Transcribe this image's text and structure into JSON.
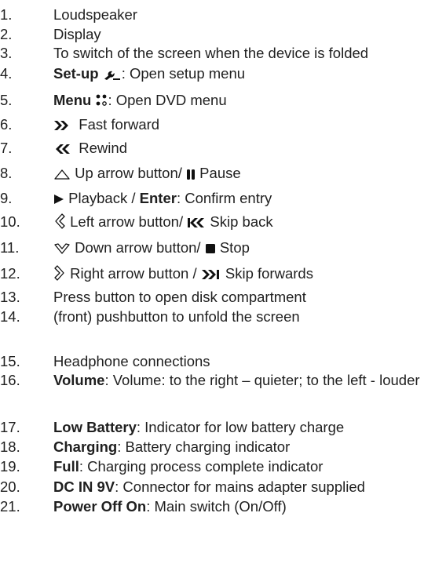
{
  "items": [
    {
      "num": "1.",
      "segments": [
        {
          "text": "Loudspeaker"
        }
      ]
    },
    {
      "num": "2.",
      "segments": [
        {
          "text": "Display"
        }
      ]
    },
    {
      "num": "3.",
      "segments": [
        {
          "text": "To switch of the screen when the device is folded"
        }
      ]
    },
    {
      "num": "4.",
      "segments": [
        {
          "text": "Set-up ",
          "bold": true
        },
        {
          "icon": "wrench-icon"
        },
        {
          "text": ": Open setup menu"
        }
      ]
    },
    {
      "num": "5.",
      "segments": [
        {
          "text": "Menu ",
          "bold": true
        },
        {
          "icon": "menu-dots-icon"
        },
        {
          "text": ": Open DVD menu"
        }
      ]
    },
    {
      "num": "6.",
      "segments": [
        {
          "icon": "fast-forward-icon"
        },
        {
          "text": "  Fast forward"
        }
      ]
    },
    {
      "num": "7.",
      "segments": [
        {
          "icon": "rewind-icon"
        },
        {
          "text": "  Rewind"
        }
      ]
    },
    {
      "num": "8.",
      "segments": [
        {
          "icon": "up-arrow-icon"
        },
        {
          "text": " Up arrow button/ "
        },
        {
          "icon": "pause-icon"
        },
        {
          "text": " Pause"
        }
      ]
    },
    {
      "num": "9.",
      "segments": [
        {
          "icon": "play-icon"
        },
        {
          "text": " Playback / "
        },
        {
          "text": "Enter",
          "bold": true
        },
        {
          "text": ": Confirm entry"
        }
      ]
    },
    {
      "num": "10.",
      "segments": [
        {
          "icon": "left-arrow-icon"
        },
        {
          "text": " Left arrow button/ "
        },
        {
          "icon": "skip-back-icon"
        },
        {
          "text": " Skip back"
        }
      ]
    },
    {
      "num": "11.",
      "segments": [
        {
          "icon": "down-arrow-icon"
        },
        {
          "text": " Down arrow button/ "
        },
        {
          "icon": "stop-icon"
        },
        {
          "text": " Stop"
        }
      ]
    },
    {
      "num": "12.",
      "segments": [
        {
          "icon": "right-arrow-icon"
        },
        {
          "text": " Right arrow button / "
        },
        {
          "icon": "skip-forward-icon"
        },
        {
          "text": " Skip forwards"
        }
      ]
    },
    {
      "num": "13.",
      "segments": [
        {
          "text": "Press button to open disk compartment"
        }
      ]
    },
    {
      "num": "14.",
      "segments": [
        {
          "text": "(front) pushbutton to unfold the screen"
        }
      ]
    },
    {
      "num": "15.",
      "segments": [
        {
          "text": "Headphone connections"
        }
      ]
    },
    {
      "num": "16.",
      "segments": [
        {
          "text": "Volume",
          "bold": true
        },
        {
          "text": ": Volume: to the right – quieter; to the left - louder"
        }
      ]
    },
    {
      "num": "17.",
      "segments": [
        {
          "text": "Low Battery",
          "bold": true
        },
        {
          "text": ": Indicator for low battery charge"
        }
      ]
    },
    {
      "num": "18.",
      "segments": [
        {
          "text": "Charging",
          "bold": true
        },
        {
          "text": ": Battery charging indicator"
        }
      ]
    },
    {
      "num": "19.",
      "segments": [
        {
          "text": "Full",
          "bold": true
        },
        {
          "text": ": Charging process complete indicator"
        }
      ]
    },
    {
      "num": "20.",
      "segments": [
        {
          "text": "DC IN 9V",
          "bold": true
        },
        {
          "text": ": Connector for mains adapter supplied"
        }
      ]
    },
    {
      "num": "21.",
      "segments": [
        {
          "text": "Power Off On",
          "bold": true
        },
        {
          "text": ": Main switch (On/Off)"
        }
      ]
    }
  ]
}
